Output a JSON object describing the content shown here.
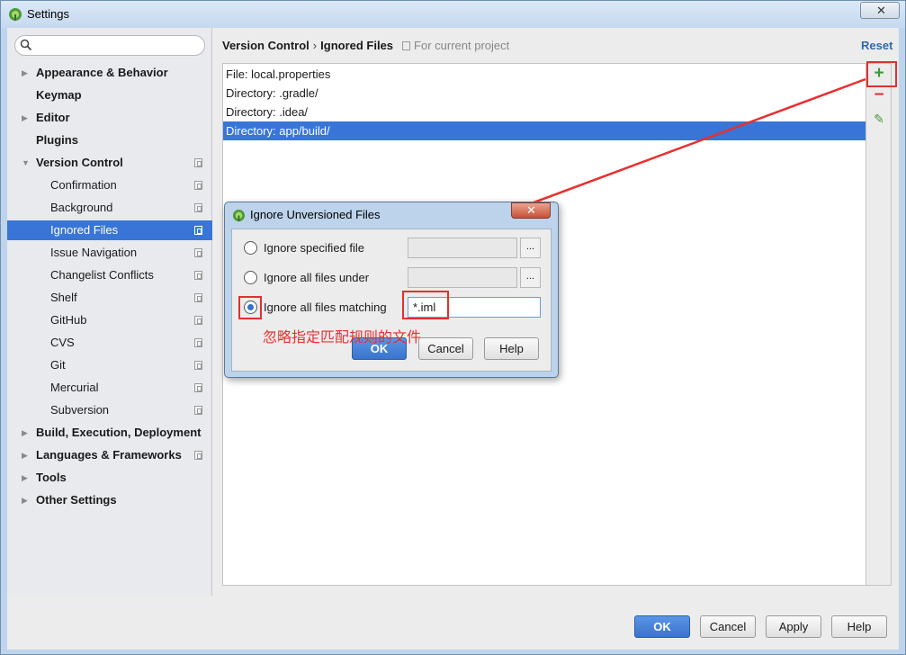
{
  "window": {
    "title": "Settings",
    "close_glyph": "✕"
  },
  "search": {
    "placeholder": ""
  },
  "sidebar": {
    "items": [
      {
        "label": "Appearance & Behavior"
      },
      {
        "label": "Keymap"
      },
      {
        "label": "Editor"
      },
      {
        "label": "Plugins"
      },
      {
        "label": "Version Control"
      },
      {
        "label": "Confirmation"
      },
      {
        "label": "Background"
      },
      {
        "label": "Ignored Files"
      },
      {
        "label": "Issue Navigation"
      },
      {
        "label": "Changelist Conflicts"
      },
      {
        "label": "Shelf"
      },
      {
        "label": "GitHub"
      },
      {
        "label": "CVS"
      },
      {
        "label": "Git"
      },
      {
        "label": "Mercurial"
      },
      {
        "label": "Subversion"
      },
      {
        "label": "Build, Execution, Deployment"
      },
      {
        "label": "Languages & Frameworks"
      },
      {
        "label": "Tools"
      },
      {
        "label": "Other Settings"
      }
    ]
  },
  "header": {
    "crumb1": "Version Control",
    "crumb_sep": "›",
    "crumb2": "Ignored Files",
    "scope": "For current project",
    "reset": "Reset"
  },
  "ignored_list": [
    "File: local.properties",
    "Directory: .gradle/",
    "Directory: .idea/",
    "Directory: app/build/"
  ],
  "toolbar": {
    "add": "+",
    "remove": "−",
    "edit": "✎"
  },
  "footer": {
    "ok": "OK",
    "cancel": "Cancel",
    "apply": "Apply",
    "help": "Help"
  },
  "dialog": {
    "title": "Ignore Unversioned Files",
    "close_glyph": "✕",
    "opt1": "Ignore specified file",
    "opt2": "Ignore all files under",
    "opt3": "Ignore all files matching",
    "pattern_value": "*.iml",
    "browse": "...",
    "ok": "OK",
    "cancel": "Cancel",
    "help": "Help"
  },
  "annotation": "忽略指定匹配规则的文件",
  "colors": {
    "accent": "#3875d7",
    "annotation": "#e83030"
  }
}
